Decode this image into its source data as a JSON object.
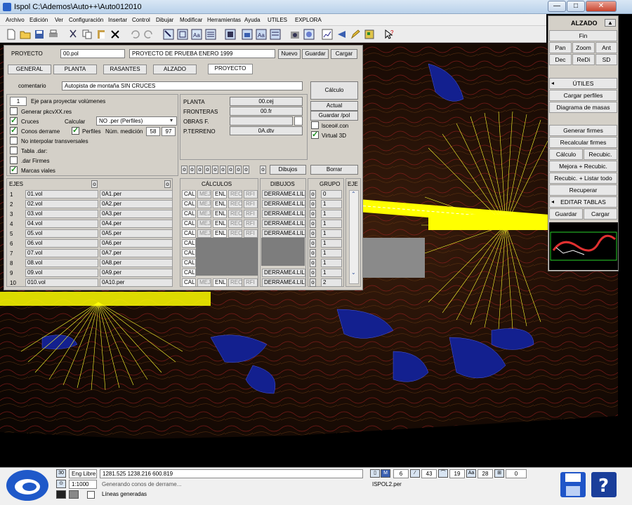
{
  "window": {
    "title": "Ispol  C:\\Ademos\\Auto++\\Auto012010",
    "min": "—",
    "max": "□",
    "close": "✕"
  },
  "menu": [
    "Archivo",
    "Edición",
    "Ver",
    "Configuración",
    "Insertar",
    "Control",
    "Dibujar",
    "Modificar",
    "Herramientas",
    "Ayuda",
    "UTILES",
    "EXPLORA"
  ],
  "toolbar_icons": [
    "new-icon",
    "open-icon",
    "save-icon",
    "print-icon",
    "cut-icon",
    "copy-icon",
    "paste-icon",
    "delete-icon",
    "undo-icon",
    "redo-icon",
    "select-icon",
    "zoom-window-icon",
    "zoom-all-icon",
    "properties-icon",
    "layers-icon",
    "view1-icon",
    "view2-icon",
    "view3-icon",
    "view4-icon",
    "render-icon",
    "settings-icon",
    "chart-icon",
    "arrow-icon",
    "pencil-icon",
    "palette-icon",
    "help-pointer-icon"
  ],
  "dialog": {
    "proyecto_label": "PROYECTO",
    "proyecto_file": "00.pol",
    "proyecto_name": "PROYECTO DE PRUEBA ENERO 1999",
    "btn_nuevo": "Nuevo",
    "btn_guardar": "Guardar",
    "btn_cargar": "Cargar",
    "tabs": [
      "GENERAL",
      "PLANTA",
      "RASANTES",
      "ALZADO",
      "PROYECTO"
    ],
    "comentario_label": "comentario",
    "comentario_value": "Autopista de montaña SIN CRUCES",
    "eje_num": "1",
    "eje_label": "Eje para proyectar volúmenes",
    "generar_label": "Generar pkcvXX.res",
    "cruces_label": "Cruces",
    "calcular_label": "Calcular",
    "calcular_value": "NO .per (Perfiles)",
    "conos_label": "Conos derrame",
    "perfiles_label": "Perfiles",
    "num_medicion_label": "Núm. medición",
    "num_a": "58",
    "num_b": "97",
    "no_interpolar": "No interpolar transversales",
    "tabla_dar": "Tabla .dar:",
    "dar_firmes": ".dar Firmes",
    "marcas_viales": "Marcas viales",
    "planta_label": "PLANTA",
    "planta_value": "00.cej",
    "fronteras_label": "FRONTERAS",
    "fronteras_value": "00.fr",
    "obras_label": "OBRAS F.",
    "obras_value": "",
    "pterreno_label": "P.TERRENO",
    "pterreno_value": "0A.dtv",
    "btn_calculo": "Cálculo",
    "btn_actual": "Actual",
    "btn_guardar_pol": "Guardar /pol",
    "lsceo_label": "lsceo#.con",
    "virtual_label": "Virtual 3D",
    "btn_dibujos": "Dibujos",
    "btn_borrar": "Borrar",
    "small_o": "o",
    "ejes_header": "EJES",
    "calculos_header": "CÁLCULOS",
    "dibujos_header": "DIBUJOS",
    "grupo_header": "GRUPO",
    "eje_header": "EJE",
    "rows": [
      {
        "n": "1",
        "vol": "01.vol",
        "per": "0A1.per",
        "calc": true,
        "dib": "DERRAME4.LIL",
        "grupo": "0"
      },
      {
        "n": "2",
        "vol": "02.vol",
        "per": "0A2.per",
        "calc": true,
        "dib": "DERRAME4.LIL",
        "grupo": "1"
      },
      {
        "n": "3",
        "vol": "03.vol",
        "per": "0A3.per",
        "calc": true,
        "dib": "DERRAME4.LIL",
        "grupo": "1"
      },
      {
        "n": "4",
        "vol": "04.vol",
        "per": "0A4.per",
        "calc": true,
        "dib": "DERRAME4.LIL",
        "grupo": "1"
      },
      {
        "n": "5",
        "vol": "05.vol",
        "per": "0A5.per",
        "calc": true,
        "dib": "DERRAME4.LIL",
        "grupo": "1"
      },
      {
        "n": "6",
        "vol": "06.vol",
        "per": "0A6.per",
        "calc": false,
        "dib": "",
        "grupo": "1"
      },
      {
        "n": "7",
        "vol": "07.vol",
        "per": "0A7.per",
        "calc": false,
        "dib": "",
        "grupo": "1"
      },
      {
        "n": "8",
        "vol": "08.vol",
        "per": "0A8.per",
        "calc": false,
        "dib": "",
        "grupo": "1"
      },
      {
        "n": "9",
        "vol": "09.vol",
        "per": "0A9.per",
        "calc": false,
        "dib": "DERRAME4.LIL",
        "grupo": "1"
      },
      {
        "n": "10",
        "vol": "010.vol",
        "per": "0A10.per",
        "calc": true,
        "dib": "DERRAME4.LIL",
        "grupo": "2"
      }
    ],
    "calc_cols": [
      "CAL",
      "MEJ",
      "ENL",
      "REC",
      "RFI"
    ]
  },
  "right_panel": {
    "title": "ALZADO",
    "fin": "Fin",
    "pan": "Pan",
    "zoom": "Zoom",
    "ant": "Ant",
    "dec": "Dec",
    "redi": "ReDi",
    "sd": "SD",
    "utiles": "ÚTILES",
    "cargar_perfiles": "Cargar perfiles",
    "diagrama": "Diagrama de masas",
    "generar_firmes": "Generar firmes",
    "recalcular_firmes": "Recalcular firmes",
    "calculo": "Cálculo",
    "recubic": "Recubic.",
    "mejora": "Mejora + Recubic.",
    "recubic_listar": "Recubic. + Listar todo",
    "recuperar": "Recuperar",
    "editar_tablas": "EDITAR TABLAS",
    "guardar": "Guardar",
    "cargar": "Cargar"
  },
  "statusbar": {
    "scale_icon_text": "30",
    "eng": "Eng Libre",
    "coords": "1281.525      1238.216    600.819",
    "scale": "1:1000",
    "message1": "Generando conos de derrame...",
    "message2": "Líneas generadas",
    "file": "ISPOL2.per",
    "m_icon": "M",
    "n1": "6",
    "n2": "43",
    "n3": "19",
    "aa": "Aa",
    "n4": "28",
    "n5": "0"
  },
  "colors": {
    "dialog_bg": "#d4d0c8",
    "canvas_bg": "#1d0d05",
    "yellow": "#ffff00",
    "blue": "#0a1a8c"
  }
}
